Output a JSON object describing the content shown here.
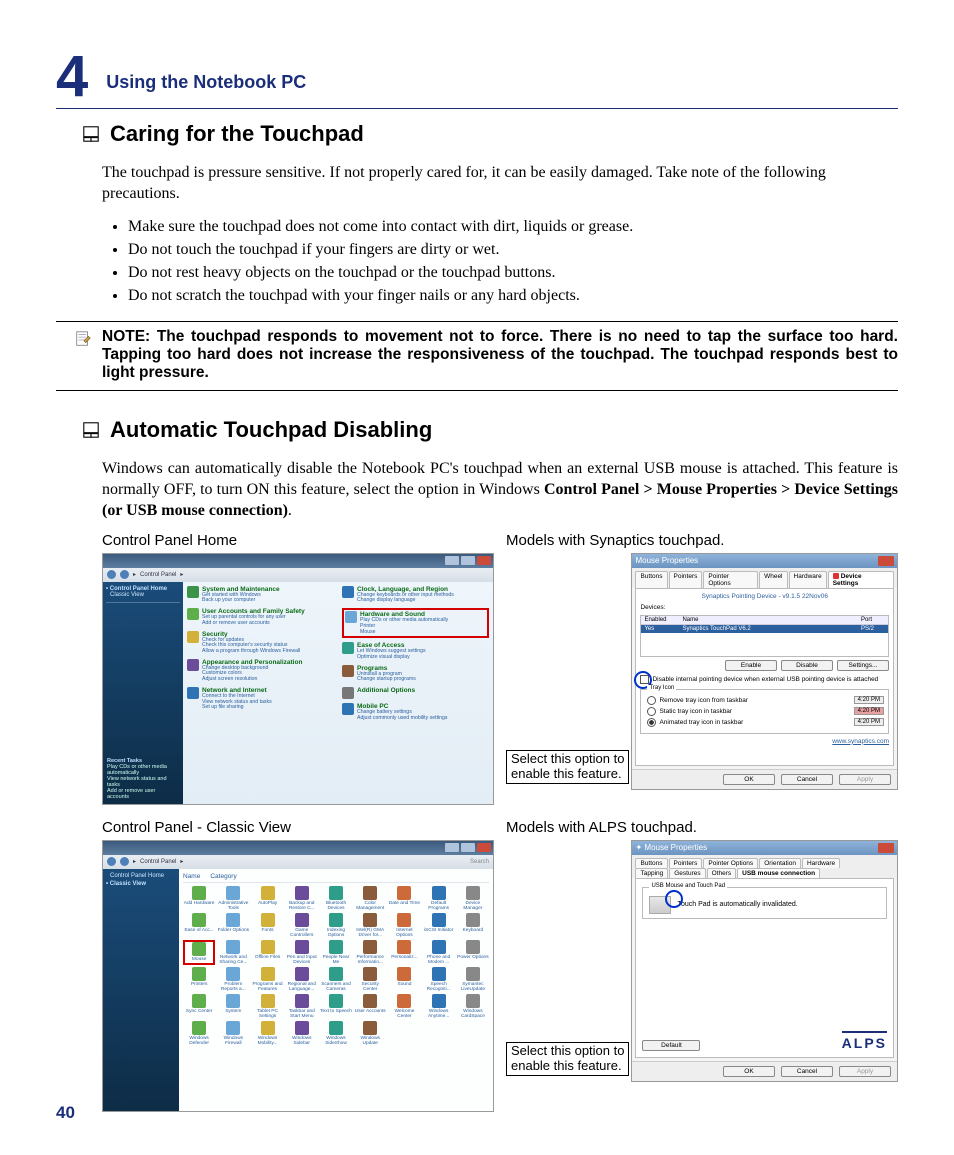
{
  "chapter": {
    "number": "4",
    "title": "Using the Notebook PC"
  },
  "section1": {
    "title": "Caring for the Touchpad",
    "intro": "The touchpad is pressure sensitive. If not properly cared for, it can be easily damaged. Take note of the following precautions.",
    "bullets": [
      "Make sure the touchpad does not come into contact with dirt, liquids or grease.",
      "Do not touch the touchpad if your fingers are dirty or wet.",
      "Do not rest heavy objects on the touchpad or the touchpad buttons.",
      "Do not scratch the touchpad with your finger nails or any hard objects."
    ],
    "note": "NOTE:  The touchpad responds to movement not to force. There is no need to tap the surface too hard. Tapping too hard does not increase the responsiveness of the touchpad. The touchpad responds best to light pressure."
  },
  "section2": {
    "title": "Automatic Touchpad Disabling",
    "intro_a": "Windows can automatically disable the Notebook PC's touchpad when an external USB mouse is attached. This feature is normally OFF, to turn ON this feature, select the option in Windows ",
    "intro_b_bold": "Control Panel > Mouse Properties > Device Settings (or USB mouse connection)",
    "intro_c": "."
  },
  "captions": {
    "cp_home": "Control Panel Home",
    "synaptics": "Models with Synaptics touchpad.",
    "cp_classic": "Control Panel - Classic View",
    "alps": "Models with ALPS touchpad.",
    "callout": "Select this option to\nenable this feature."
  },
  "cp_home": {
    "breadcrumb": "Control Panel",
    "side": {
      "home": "Control Panel Home",
      "classic": "Classic View",
      "recent_title": "Recent Tasks",
      "recent1": "Play CDs or other media automatically",
      "recent2": "View network status and tasks",
      "recent3": "Add or remove user accounts"
    },
    "cats": [
      {
        "t": "System and Maintenance",
        "d": "Get started with Windows\nBack up your computer",
        "c": "#3b9348"
      },
      {
        "t": "User Accounts and Family Safety",
        "d": "Set up parental controls for any user\nAdd or remove user accounts",
        "c": "#5fae4c"
      },
      {
        "t": "Security",
        "d": "Check for updates\nCheck this computer's security status\nAllow a program through Windows Firewall",
        "c": "#d2b13a"
      },
      {
        "t": "Appearance and Personalization",
        "d": "Change desktop background\nCustomize colors\nAdjust screen resolution",
        "c": "#6b4c9a"
      },
      {
        "t": "Network and Internet",
        "d": "Connect to the Internet\nView network status and tasks\nSet up file sharing",
        "c": "#2e74b5"
      },
      {
        "t": "Clock, Language, and Region",
        "d": "Change keyboards or other input methods\nChange display language",
        "c": "#2e74b5"
      },
      {
        "t": "Hardware and Sound",
        "d": "Play CDs or other media automatically\nPrinter\nMouse",
        "c": "#6aa7d6",
        "hw": true
      },
      {
        "t": "Ease of Access",
        "d": "Let Windows suggest settings\nOptimize visual display",
        "c": "#2e9e8a"
      },
      {
        "t": "Programs",
        "d": "Uninstall a program\nChange startup programs",
        "c": "#8a5c3b"
      },
      {
        "t": "Additional Options",
        "d": "",
        "c": "#777"
      },
      {
        "t": "Mobile PC",
        "d": "Change battery settings\nAdjust commonly used mobility settings",
        "c": "#2e74b5"
      }
    ]
  },
  "synaptics": {
    "title": "Mouse Properties",
    "tabs": [
      "Buttons",
      "Pointers",
      "Pointer Options",
      "Wheel",
      "Hardware",
      "Device Settings"
    ],
    "device_header": "Synaptics Pointing Device - v9.1.5 22Nov06",
    "devices_label": "Devices:",
    "cols": {
      "enabled": "Enabled",
      "name": "Name",
      "port": "Port"
    },
    "row": {
      "enabled": "Yes",
      "name": "Synaptics TouchPad V6.2",
      "port": "PS/2"
    },
    "buttons": {
      "enable": "Enable",
      "disable": "Disable",
      "settings": "Settings..."
    },
    "checkbox": "Disable internal pointing device when external USB pointing device is attached",
    "tray_group": "Tray Icon",
    "radios": [
      {
        "label": "Remove tray icon from taskbar",
        "time": "4:20 PM"
      },
      {
        "label": "Static tray icon in taskbar",
        "time": "4:20 PM",
        "red": true
      },
      {
        "label": "Animated tray icon in taskbar",
        "time": "4:20 PM"
      }
    ],
    "link": "www.synaptics.com",
    "footer": {
      "ok": "OK",
      "cancel": "Cancel",
      "apply": "Apply"
    }
  },
  "cp_classic": {
    "side": {
      "home": "Control Panel Home",
      "classic": "Classic View"
    },
    "head": {
      "name": "Name",
      "category": "Category"
    },
    "icons": [
      "Add Hardware",
      "Administrative Tools",
      "AutoPlay",
      "Backup and Restore C...",
      "Bluetooth Devices",
      "Color Management",
      "Date and Time",
      "Default Programs",
      "Device Manager",
      "Ease of Acc...",
      "Folder Options",
      "Fonts",
      "Game Controllers",
      "Indexing Options",
      "Intel(R) GMA Driver for...",
      "Internet Options",
      "iSCSI Initiator",
      "Keyboard",
      "Mouse",
      "Network and Sharing Ce...",
      "Offline Files",
      "Pen and Input Devices",
      "People Near Me",
      "Performance Informatio...",
      "Personaliz...",
      "Phone and Modem ...",
      "Power Options",
      "Printers",
      "Problem Reports a...",
      "Programs and Features",
      "Regional and Language...",
      "Scanners and Cameras",
      "Security Center",
      "Sound",
      "Speech Recogniti...",
      "Symantec LiveUpdate",
      "Sync Center",
      "System",
      "Tablet PC Settings",
      "Taskbar and Start Menu",
      "Text to Speech",
      "User Accounts",
      "Welcome Center",
      "Windows Anytime...",
      "Windows CardSpace",
      "Windows Defender",
      "Windows Firewall",
      "Windows Mobility...",
      "Windows Sidebar",
      "Windows SideShow",
      "Windows Update"
    ]
  },
  "alps": {
    "title": "Mouse Properties",
    "tabs_top": [
      "Buttons",
      "Pointers",
      "Pointer Options",
      "Orientation",
      "Hardware"
    ],
    "tabs_bot": [
      "Tapping",
      "Gestures",
      "Others",
      "USB mouse connection"
    ],
    "group": "USB Mouse and Touch Pad",
    "msg": "Touch Pad is automatically invalidated.",
    "default": "Default",
    "logo": "ALPS",
    "footer": {
      "ok": "OK",
      "cancel": "Cancel",
      "apply": "Apply"
    }
  },
  "page_number": "40"
}
